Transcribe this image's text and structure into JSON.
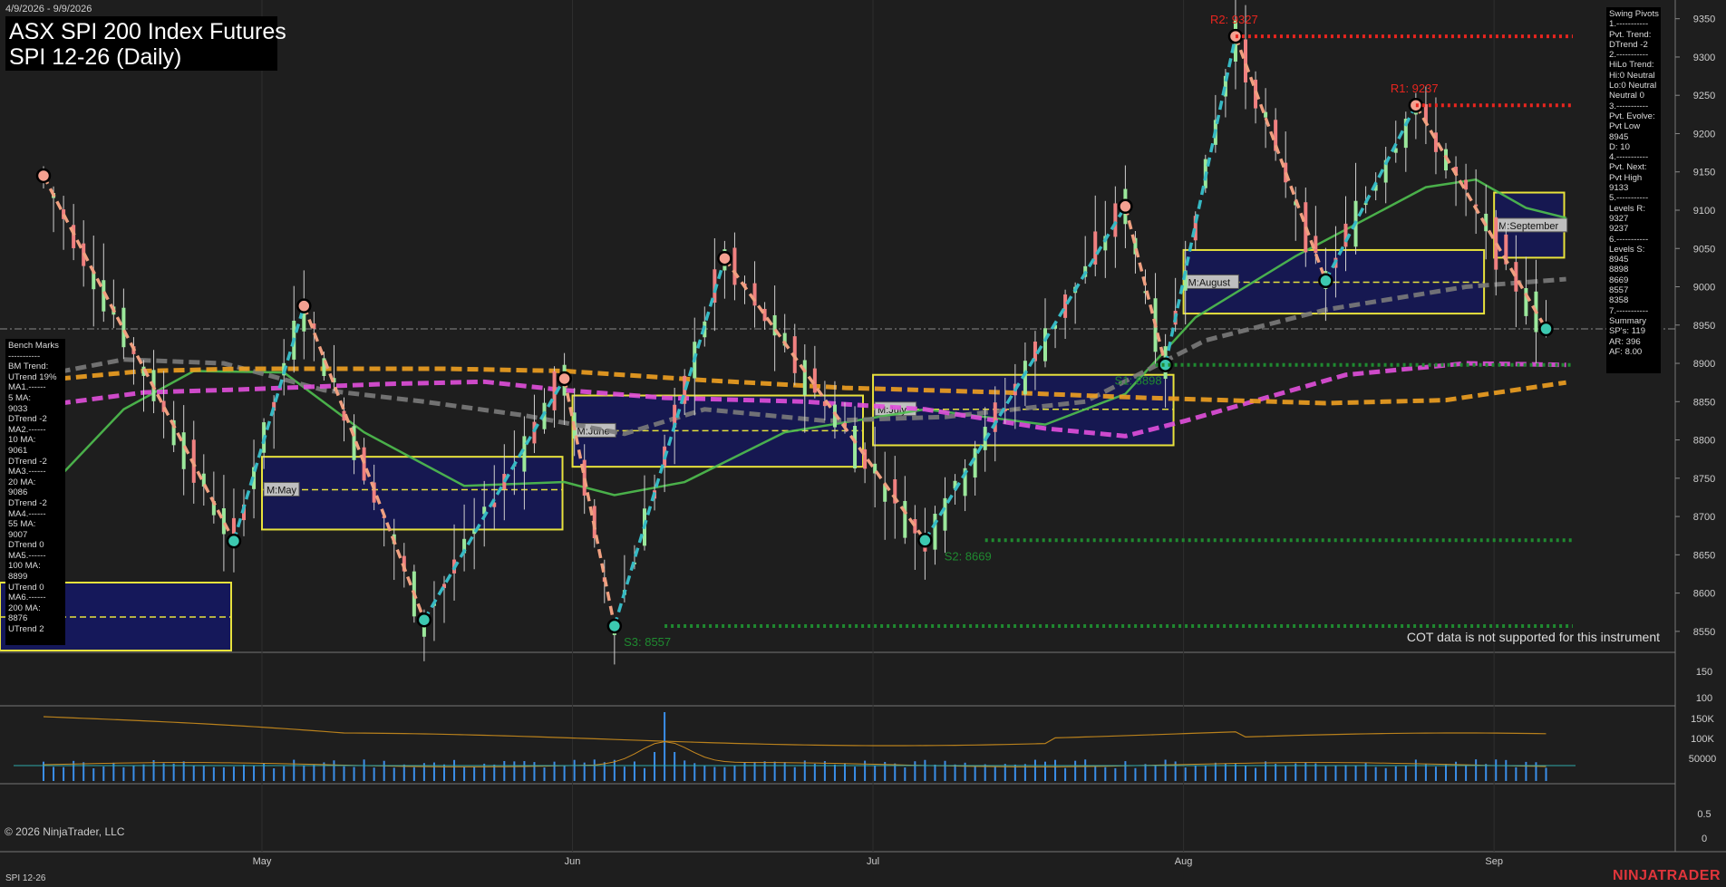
{
  "header": {
    "date_range": "4/9/2026 - 9/9/2026",
    "title_line1": "ASX SPI 200 Index Futures",
    "title_line2": "SPI 12-26 (Daily)"
  },
  "footer": {
    "copyright": "© 2026 NinjaTrader, LLC",
    "instrument": "SPI 12-26",
    "brand": "NINJATRADER",
    "cot_note": "COT data is not supported for this instrument"
  },
  "bench_marks": [
    "Bench Marks",
    "-----------",
    "BM Trend:",
    "UTrend 19%",
    "MA1.------",
    "5 MA:",
    "9033",
    "DTrend -2",
    "MA2.------",
    "10 MA:",
    "9061",
    "DTrend -2",
    "MA3.------",
    "20 MA:",
    "9086",
    "DTrend -2",
    "MA4.------",
    "55 MA:",
    "9007",
    "DTrend 0",
    "MA5.------",
    "100 MA:",
    "8899",
    "UTrend 0",
    "MA6.------",
    "200 MA:",
    "8876",
    "UTrend 2"
  ],
  "swing_pivots": [
    "Swing Pivots",
    "1.-----------",
    "Pvt. Trend:",
    "DTrend -2",
    "2.-----------",
    "HiLo Trend:",
    "Hi:0 Neutral",
    "Lo:0 Neutral",
    "Neutral 0",
    "3.-----------",
    "Pvt. Evolve:",
    "Pvt Low",
    "8945",
    "D: 10",
    "4.-----------",
    "Pvt. Next:",
    "Pvt High",
    "9133",
    "5.-----------",
    "Levels R:",
    "9327",
    "9237",
    "6.-----------",
    "Levels S:",
    "8945",
    "8898",
    "8669",
    "8557",
    "8358",
    "7.-----------",
    "Summary",
    "SP's: 119",
    "AR: 396",
    "AF: 8.00"
  ],
  "chart_data": {
    "type": "candlestick",
    "instrument": "SPI 12-26",
    "period": "Daily",
    "y_axis": {
      "min": 8525,
      "max": 9365,
      "ticks": [
        8550,
        8600,
        8650,
        8700,
        8750,
        8800,
        8850,
        8900,
        8950,
        9000,
        9050,
        9100,
        9150,
        9200,
        9250,
        9300,
        9350
      ]
    },
    "x_labels": [
      {
        "label": "May",
        "day": 20
      },
      {
        "label": "Jun",
        "day": 51
      },
      {
        "label": "Jul",
        "day": 81
      },
      {
        "label": "Aug",
        "day": 112
      },
      {
        "label": "Sep",
        "day": 143
      }
    ],
    "pivot_labels": [
      {
        "text": "R2: 9327",
        "day": 119,
        "price": 9327,
        "color": "#e8251f"
      },
      {
        "text": "R1: 9237",
        "day": 137,
        "price": 9237,
        "color": "#e8251f"
      },
      {
        "text": "S1: 8898",
        "day": 111,
        "price": 8898,
        "color": "#1f8a30"
      },
      {
        "text": "S2: 8669",
        "day": 94,
        "price": 8669,
        "color": "#1f8a30"
      },
      {
        "text": "S3: 8557",
        "day": 62,
        "price": 8557,
        "color": "#1f8a30"
      }
    ],
    "monthly_boxes": [
      {
        "label": "M:May",
        "start": 20,
        "end": 50,
        "low": 8683,
        "high": 8778,
        "mid": 8735
      },
      {
        "label": "M:June",
        "start": 51,
        "end": 80,
        "low": 8765,
        "high": 8858,
        "mid": 8812
      },
      {
        "label": "M:July",
        "start": 81,
        "end": 111,
        "low": 8793,
        "high": 8885,
        "mid": 8840
      },
      {
        "label": "M:August",
        "start": 112,
        "end": 142,
        "low": 8965,
        "high": 9048,
        "mid": 9006
      },
      {
        "label": "M:September",
        "start": 143,
        "end": 150,
        "low": 9038,
        "high": 9123,
        "mid": 9080
      }
    ],
    "swing_points": [
      {
        "day": 0,
        "price": 9145,
        "type": "high"
      },
      {
        "day": 19,
        "price": 8668,
        "type": "low"
      },
      {
        "day": 26,
        "price": 8975,
        "type": "high"
      },
      {
        "day": 38,
        "price": 8565,
        "type": "low"
      },
      {
        "day": 52,
        "price": 8880,
        "type": "high"
      },
      {
        "day": 57,
        "price": 8557,
        "type": "low"
      },
      {
        "day": 68,
        "price": 9037,
        "type": "high"
      },
      {
        "day": 88,
        "price": 8669,
        "type": "low"
      },
      {
        "day": 108,
        "price": 9105,
        "type": "high"
      },
      {
        "day": 112,
        "price": 8898,
        "type": "low"
      },
      {
        "day": 119,
        "price": 9327,
        "type": "high"
      },
      {
        "day": 128,
        "price": 9008,
        "type": "low"
      },
      {
        "day": 137,
        "price": 9237,
        "type": "high"
      },
      {
        "day": 150,
        "price": 8945,
        "type": "low"
      }
    ],
    "ma_lines": [
      {
        "name": "5 MA",
        "color": "#4fc04f",
        "values": [
          [
            0,
            8730
          ],
          [
            8,
            8840
          ],
          [
            15,
            8890
          ],
          [
            24,
            8888
          ],
          [
            32,
            8810
          ],
          [
            42,
            8740
          ],
          [
            52,
            8745
          ],
          [
            57,
            8728
          ],
          [
            64,
            8745
          ],
          [
            74,
            8810
          ],
          [
            88,
            8840
          ],
          [
            100,
            8820
          ],
          [
            108,
            8860
          ],
          [
            115,
            8960
          ],
          [
            125,
            9040
          ],
          [
            138,
            9130
          ],
          [
            143,
            9140
          ],
          [
            148,
            9103
          ],
          [
            152,
            9090
          ]
        ]
      },
      {
        "name": "200 MA",
        "color": "#7a7a7a",
        "values": [
          [
            0,
            8885
          ],
          [
            8,
            8905
          ],
          [
            18,
            8900
          ],
          [
            28,
            8865
          ],
          [
            38,
            8850
          ],
          [
            48,
            8832
          ],
          [
            58,
            8808
          ],
          [
            66,
            8840
          ],
          [
            78,
            8825
          ],
          [
            90,
            8830
          ],
          [
            104,
            8850
          ],
          [
            116,
            8930
          ],
          [
            128,
            8970
          ],
          [
            142,
            9000
          ],
          [
            152,
            9010
          ]
        ]
      },
      {
        "name": "100 MA",
        "color": "#e14fdb",
        "values": [
          [
            0,
            8845
          ],
          [
            10,
            8862
          ],
          [
            20,
            8866
          ],
          [
            34,
            8873
          ],
          [
            44,
            8876
          ],
          [
            52,
            8865
          ],
          [
            62,
            8855
          ],
          [
            76,
            8850
          ],
          [
            88,
            8840
          ],
          [
            100,
            8815
          ],
          [
            108,
            8805
          ],
          [
            114,
            8825
          ],
          [
            130,
            8885
          ],
          [
            142,
            8900
          ],
          [
            152,
            8898
          ]
        ]
      },
      {
        "name": "55 MA",
        "color": "#f0a020",
        "values": [
          [
            0,
            8878
          ],
          [
            10,
            8890
          ],
          [
            20,
            8893
          ],
          [
            40,
            8893
          ],
          [
            52,
            8890
          ],
          [
            66,
            8878
          ],
          [
            80,
            8868
          ],
          [
            96,
            8862
          ],
          [
            110,
            8855
          ],
          [
            128,
            8848
          ],
          [
            140,
            8852
          ],
          [
            152,
            8875
          ]
        ]
      }
    ],
    "volume_axis_ticks": [
      "150K",
      "100K",
      "50000"
    ],
    "oscillator_axis_ticks": [
      "150",
      "100"
    ],
    "lower_axis_ticks": [
      "0.5",
      "0"
    ]
  }
}
